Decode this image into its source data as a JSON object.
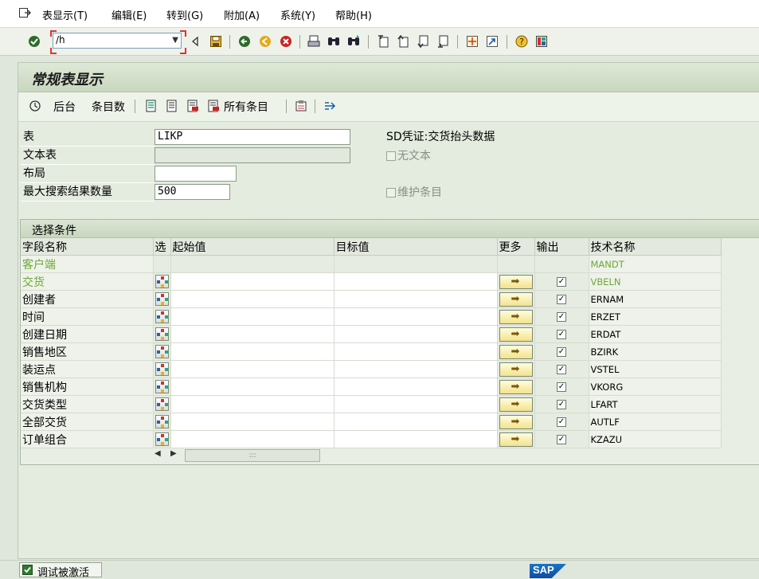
{
  "menu": {
    "items": [
      "表显示(T)",
      "编辑(E)",
      "转到(G)",
      "附加(A)",
      "系统(Y)",
      "帮助(H)"
    ]
  },
  "system_toolbar": {
    "command_value": "/h"
  },
  "screen": {
    "title": "常规表显示"
  },
  "app_toolbar": {
    "background_label": "后台",
    "entries_label": "条目数",
    "all_entries_label": "所有条目"
  },
  "fields": {
    "table_label": "表",
    "table_value": "LIKP",
    "table_desc": "SD凭证:交货抬头数据",
    "text_table_label": "文本表",
    "text_table_value": "",
    "no_text_label": "无文本",
    "layout_label": "布局",
    "layout_value": "",
    "max_hits_label": "最大搜索结果数量",
    "max_hits_value": "500",
    "maintain_entries_label": "维护条目"
  },
  "selection": {
    "title": "选择条件",
    "headers": {
      "field_name": "字段名称",
      "select": "选",
      "from_value": "起始值",
      "to_value": "目标值",
      "more": "更多",
      "output": "输出",
      "tech_name": "技术名称"
    },
    "rows": [
      {
        "label": "客户端",
        "tech": "MANDT",
        "key": true,
        "selectable": false
      },
      {
        "label": "交货",
        "tech": "VBELN",
        "key": true,
        "selectable": true
      },
      {
        "label": "创建者",
        "tech": "ERNAM",
        "key": false,
        "selectable": true
      },
      {
        "label": "时间",
        "tech": "ERZET",
        "key": false,
        "selectable": true
      },
      {
        "label": "创建日期",
        "tech": "ERDAT",
        "key": false,
        "selectable": true
      },
      {
        "label": "销售地区",
        "tech": "BZIRK",
        "key": false,
        "selectable": true
      },
      {
        "label": "装运点",
        "tech": "VSTEL",
        "key": false,
        "selectable": true
      },
      {
        "label": "销售机构",
        "tech": "VKORG",
        "key": false,
        "selectable": true
      },
      {
        "label": "交货类型",
        "tech": "LFART",
        "key": false,
        "selectable": true
      },
      {
        "label": "全部交货",
        "tech": "AUTLF",
        "key": false,
        "selectable": true
      },
      {
        "label": "订单组合",
        "tech": "KZAZU",
        "key": false,
        "selectable": true
      }
    ]
  },
  "status": {
    "debug_label": "调试被激活",
    "logo_text": "SAP"
  },
  "colors": {
    "key_field": "#6da836",
    "background": "#dfe6db",
    "sap_blue": "#0b4ea1"
  }
}
